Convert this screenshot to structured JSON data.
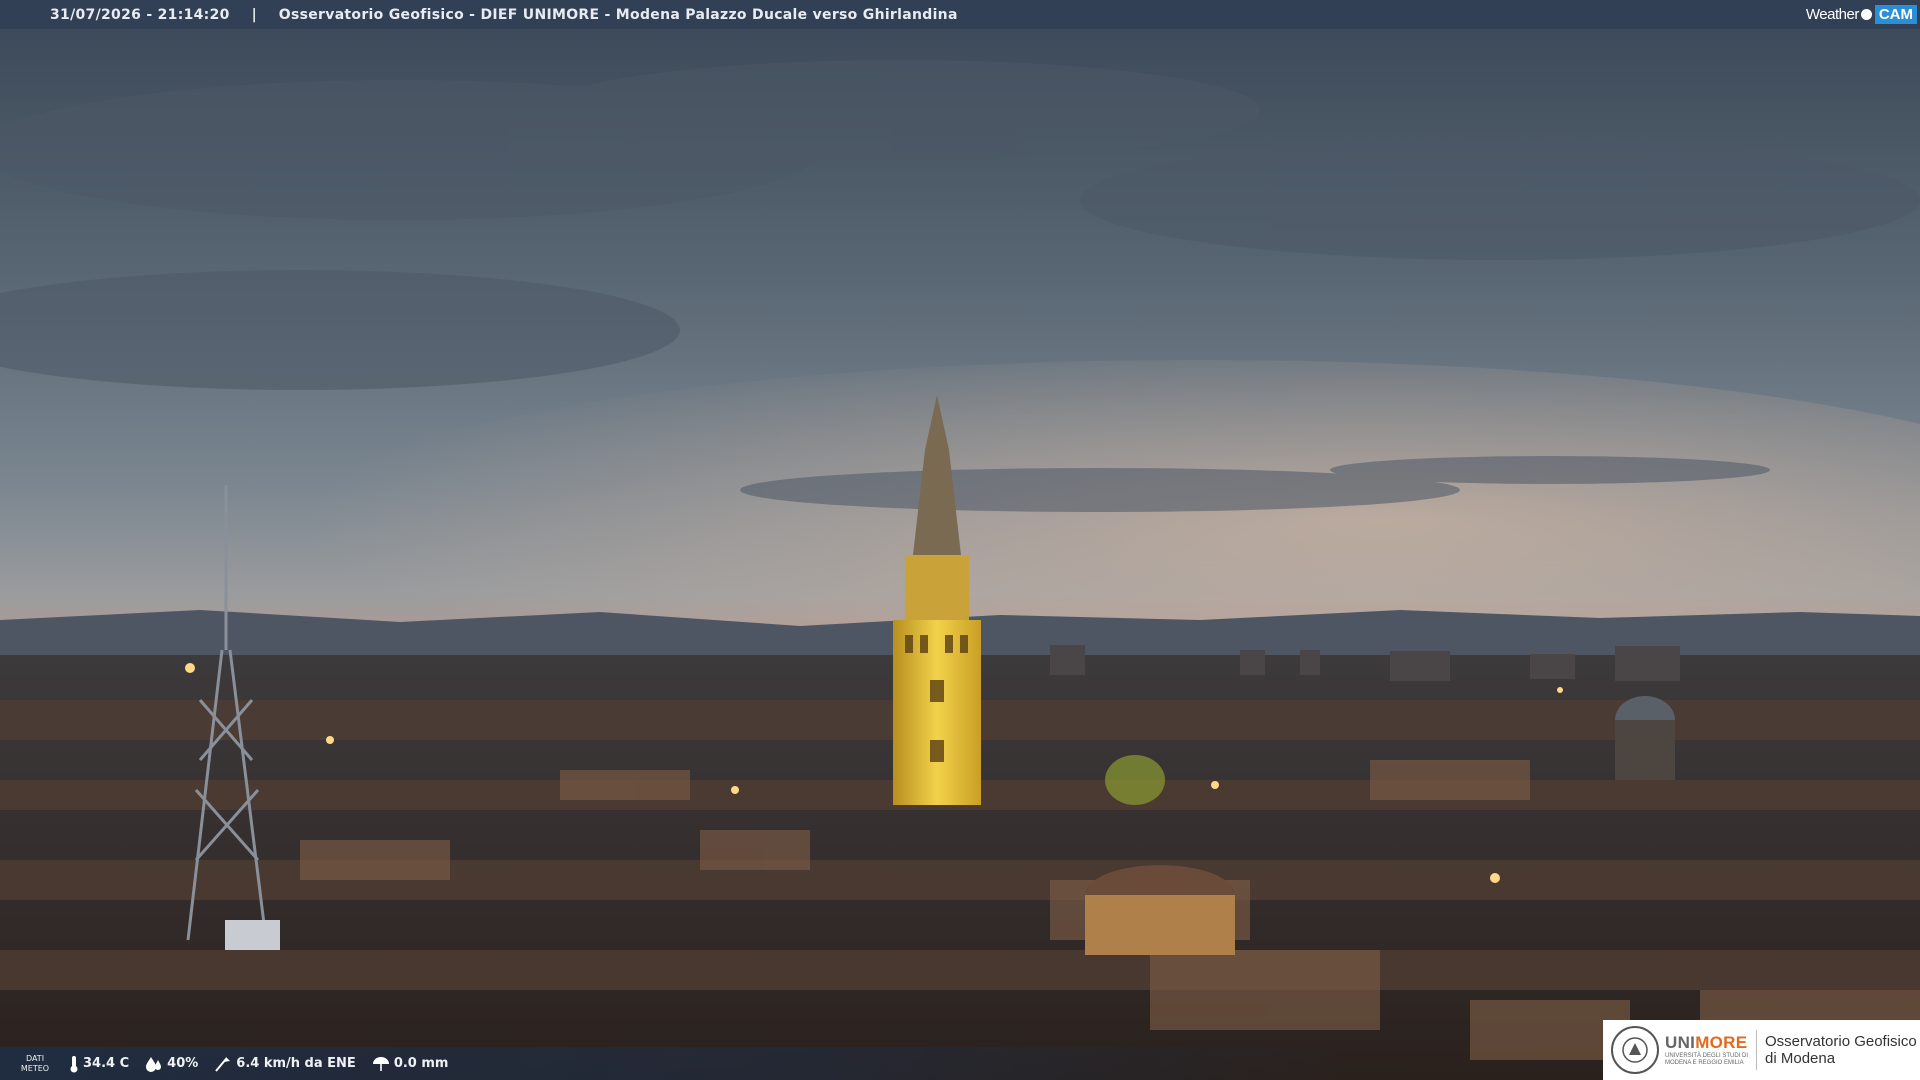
{
  "header": {
    "timestamp": "31/07/2026 - 21:14:20",
    "separator": "|",
    "title": "Osservatorio Geofisico - DIEF UNIMORE - Modena Palazzo Ducale verso Ghirlandina"
  },
  "logo": {
    "weather": "Weather",
    "cam": "CAM"
  },
  "meteo": {
    "label_line1": "DATI",
    "label_line2": "METEO",
    "temperature": "34.4 C",
    "humidity": "40%",
    "wind": "6.4 km/h da ENE",
    "rain": "0.0 mm"
  },
  "branding": {
    "uni_prefix": "UNI",
    "uni_suffix": "MORE",
    "uni_sub1": "UNIVERSITÀ DEGLI STUDI DI",
    "uni_sub2": "MODENA E REGGIO EMILIA",
    "osservatorio_line1": "Osservatorio Geofisico",
    "osservatorio_line2": "di Modena"
  },
  "colors": {
    "sky_top": "#3a4756",
    "sky_mid": "#7e8a93",
    "horizon_glow": "#c9a48c",
    "tower_light": "#e6c23a",
    "roofs": "#2e2824",
    "bar": "#304054",
    "unimore_orange": "#e26a1e",
    "cam_blue": "#2a8fd6"
  }
}
